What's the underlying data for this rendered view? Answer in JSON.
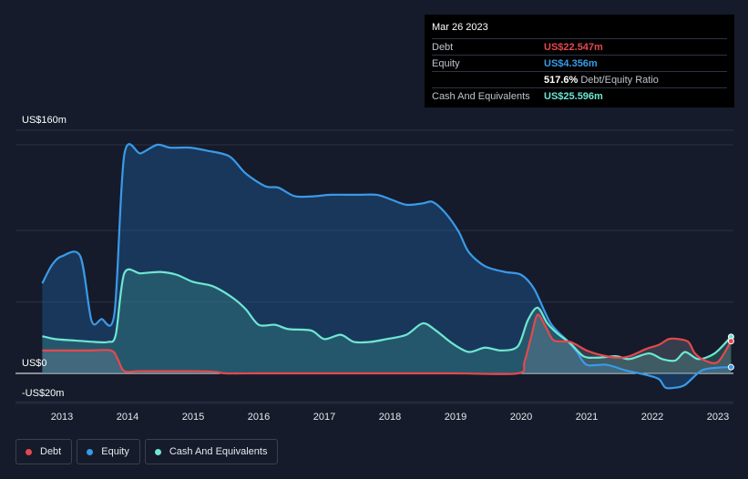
{
  "tooltip": {
    "date": "Mar 26 2023",
    "rows": [
      {
        "label": "Debt",
        "value": "US$22.547m",
        "color": "#e5484d",
        "suffix": ""
      },
      {
        "label": "Equity",
        "value": "US$4.356m",
        "color": "#3a9ae8",
        "suffix": ""
      },
      {
        "label": "",
        "value": "517.6%",
        "color": "#ffffff",
        "suffix": "Debt/Equity Ratio"
      },
      {
        "label": "Cash And Equivalents",
        "value": "US$25.596m",
        "color": "#6ee7d3",
        "suffix": ""
      }
    ]
  },
  "legend": [
    {
      "label": "Debt",
      "color": "#e5484d"
    },
    {
      "label": "Equity",
      "color": "#3a9ae8"
    },
    {
      "label": "Cash And Equivalents",
      "color": "#6ee7d3"
    }
  ],
  "chart_data": {
    "type": "area",
    "ylim": [
      -20,
      160
    ],
    "y_tick_labels": [
      {
        "value": 160,
        "text": "US$160m"
      },
      {
        "value": 0,
        "text": "US$0"
      },
      {
        "value": -20,
        "text": "-US$20m"
      }
    ],
    "x_ticks": [
      "2013",
      "2014",
      "2015",
      "2016",
      "2017",
      "2018",
      "2019",
      "2020",
      "2021",
      "2022",
      "2023"
    ],
    "xlim": [
      2012.7,
      2023.3
    ],
    "grid": true,
    "series": [
      {
        "name": "Equity",
        "color": "#3a9ae8",
        "points": [
          [
            2012.7,
            63
          ],
          [
            2012.85,
            76
          ],
          [
            2013.0,
            82
          ],
          [
            2013.28,
            82
          ],
          [
            2013.45,
            37
          ],
          [
            2013.6,
            38
          ],
          [
            2013.8,
            42
          ],
          [
            2013.95,
            153
          ],
          [
            2014.2,
            154
          ],
          [
            2014.45,
            160
          ],
          [
            2014.65,
            158
          ],
          [
            2014.95,
            158
          ],
          [
            2015.2,
            156
          ],
          [
            2015.55,
            152
          ],
          [
            2015.8,
            140
          ],
          [
            2016.1,
            131
          ],
          [
            2016.3,
            130
          ],
          [
            2016.55,
            124
          ],
          [
            2016.85,
            124
          ],
          [
            2017.1,
            125
          ],
          [
            2017.5,
            125
          ],
          [
            2017.8,
            125
          ],
          [
            2018.0,
            122
          ],
          [
            2018.25,
            118
          ],
          [
            2018.5,
            119
          ],
          [
            2018.65,
            120
          ],
          [
            2018.85,
            112
          ],
          [
            2019.05,
            99
          ],
          [
            2019.2,
            85
          ],
          [
            2019.45,
            75
          ],
          [
            2019.75,
            71
          ],
          [
            2020.0,
            69
          ],
          [
            2020.2,
            59
          ],
          [
            2020.45,
            35
          ],
          [
            2020.7,
            23
          ],
          [
            2020.85,
            15
          ],
          [
            2021.0,
            6
          ],
          [
            2021.3,
            6
          ],
          [
            2021.6,
            2
          ],
          [
            2021.9,
            -1
          ],
          [
            2022.1,
            -4
          ],
          [
            2022.2,
            -10
          ],
          [
            2022.35,
            -10
          ],
          [
            2022.5,
            -8
          ],
          [
            2022.75,
            2
          ],
          [
            2023.0,
            4
          ],
          [
            2023.2,
            4.356
          ]
        ]
      },
      {
        "name": "Cash And Equivalents",
        "color": "#6ee7d3",
        "points": [
          [
            2012.7,
            26
          ],
          [
            2012.9,
            24
          ],
          [
            2013.2,
            23
          ],
          [
            2013.5,
            22
          ],
          [
            2013.7,
            22
          ],
          [
            2013.82,
            27
          ],
          [
            2013.95,
            70
          ],
          [
            2014.2,
            70
          ],
          [
            2014.5,
            71
          ],
          [
            2014.75,
            69
          ],
          [
            2015.0,
            64
          ],
          [
            2015.3,
            61
          ],
          [
            2015.6,
            53
          ],
          [
            2015.8,
            45
          ],
          [
            2016.0,
            34
          ],
          [
            2016.25,
            34
          ],
          [
            2016.45,
            31
          ],
          [
            2016.8,
            30
          ],
          [
            2017.0,
            24
          ],
          [
            2017.25,
            27
          ],
          [
            2017.45,
            22
          ],
          [
            2017.7,
            22
          ],
          [
            2017.95,
            24
          ],
          [
            2018.25,
            27
          ],
          [
            2018.5,
            35
          ],
          [
            2018.7,
            30
          ],
          [
            2018.95,
            21
          ],
          [
            2019.2,
            15
          ],
          [
            2019.45,
            18
          ],
          [
            2019.7,
            16
          ],
          [
            2019.95,
            19
          ],
          [
            2020.1,
            37
          ],
          [
            2020.25,
            46
          ],
          [
            2020.4,
            35
          ],
          [
            2020.55,
            28
          ],
          [
            2020.75,
            21
          ],
          [
            2020.95,
            12
          ],
          [
            2021.15,
            11
          ],
          [
            2021.45,
            12
          ],
          [
            2021.65,
            10
          ],
          [
            2021.95,
            14
          ],
          [
            2022.15,
            10
          ],
          [
            2022.35,
            9
          ],
          [
            2022.5,
            15
          ],
          [
            2022.7,
            10
          ],
          [
            2022.95,
            14
          ],
          [
            2023.2,
            25.596
          ]
        ]
      },
      {
        "name": "Debt",
        "color": "#e5484d",
        "points": [
          [
            2012.7,
            16
          ],
          [
            2013.0,
            16
          ],
          [
            2013.4,
            16
          ],
          [
            2013.75,
            16
          ],
          [
            2013.85,
            10
          ],
          [
            2013.95,
            1.5
          ],
          [
            2014.2,
            1.5
          ],
          [
            2015.0,
            1.5
          ],
          [
            2015.35,
            1
          ],
          [
            2015.5,
            0
          ],
          [
            2016.0,
            0
          ],
          [
            2017.0,
            0
          ],
          [
            2018.0,
            0
          ],
          [
            2019.0,
            0
          ],
          [
            2019.95,
            0
          ],
          [
            2020.05,
            8
          ],
          [
            2020.15,
            25
          ],
          [
            2020.25,
            41
          ],
          [
            2020.38,
            32
          ],
          [
            2020.5,
            23
          ],
          [
            2020.75,
            22
          ],
          [
            2021.0,
            16
          ],
          [
            2021.2,
            13
          ],
          [
            2021.45,
            11
          ],
          [
            2021.65,
            12
          ],
          [
            2021.9,
            17
          ],
          [
            2022.1,
            20
          ],
          [
            2022.25,
            24
          ],
          [
            2022.4,
            24
          ],
          [
            2022.55,
            22
          ],
          [
            2022.65,
            14
          ],
          [
            2022.8,
            9
          ],
          [
            2023.0,
            8
          ],
          [
            2023.2,
            22.547
          ]
        ]
      }
    ]
  }
}
